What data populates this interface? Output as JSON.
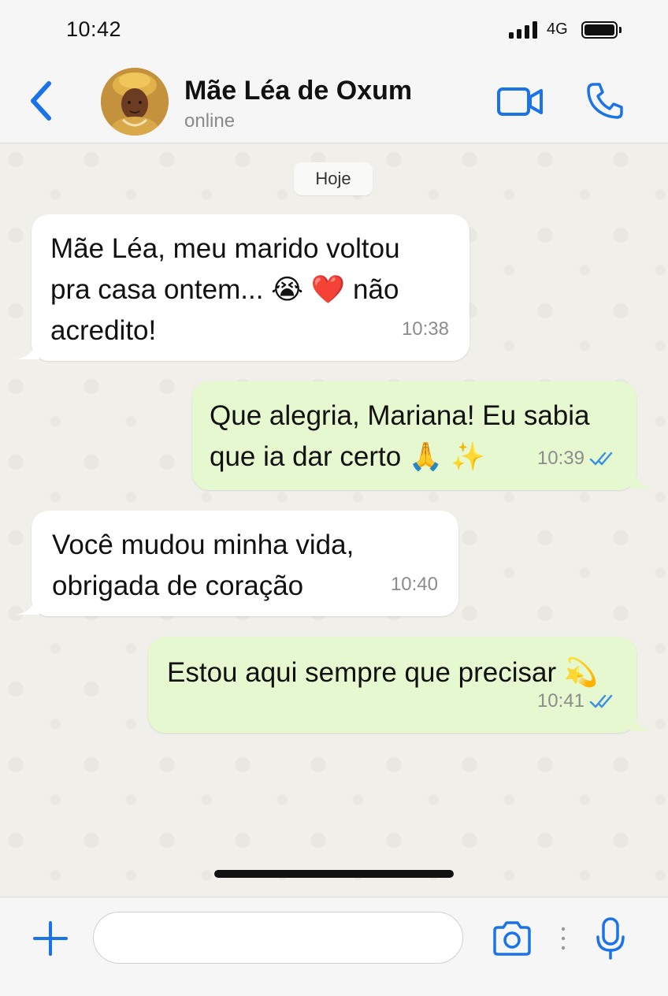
{
  "status_bar": {
    "time": "10:42",
    "network": "4G",
    "signal_bars": 4,
    "battery_level": 1.0
  },
  "header": {
    "contact_name": "Mãe Léa de Oxum",
    "contact_status": "online",
    "icons": [
      "back-chevron-icon",
      "video-call-icon",
      "phone-icon"
    ],
    "accent_color": "#1a73e8"
  },
  "chat": {
    "date_label": "Hoje",
    "messages": [
      {
        "direction": "incoming",
        "text": "Mãe Léa, meu marido voltou\npra casa ontem... 😭 ❤️ não\nacredito!",
        "time": "10:38"
      },
      {
        "direction": "outgoing",
        "text": "Que alegria, Mariana! Eu sabia\nque ia dar certo 🙏 ✨",
        "time": "10:39",
        "read": true
      },
      {
        "direction": "incoming",
        "text": "Você mudou minha vida,\nobrigada de coração",
        "time": "10:40"
      },
      {
        "direction": "outgoing",
        "text": "Estou aqui sempre que precisar 💫",
        "time": "10:41",
        "read": true
      }
    ],
    "bubble_colors": {
      "incoming": "#ffffff",
      "outgoing": "#e6f8cf"
    }
  },
  "composer": {
    "input_value": "",
    "icons": [
      "plus-icon",
      "camera-icon",
      "more-dots-icon",
      "microphone-icon"
    ]
  }
}
